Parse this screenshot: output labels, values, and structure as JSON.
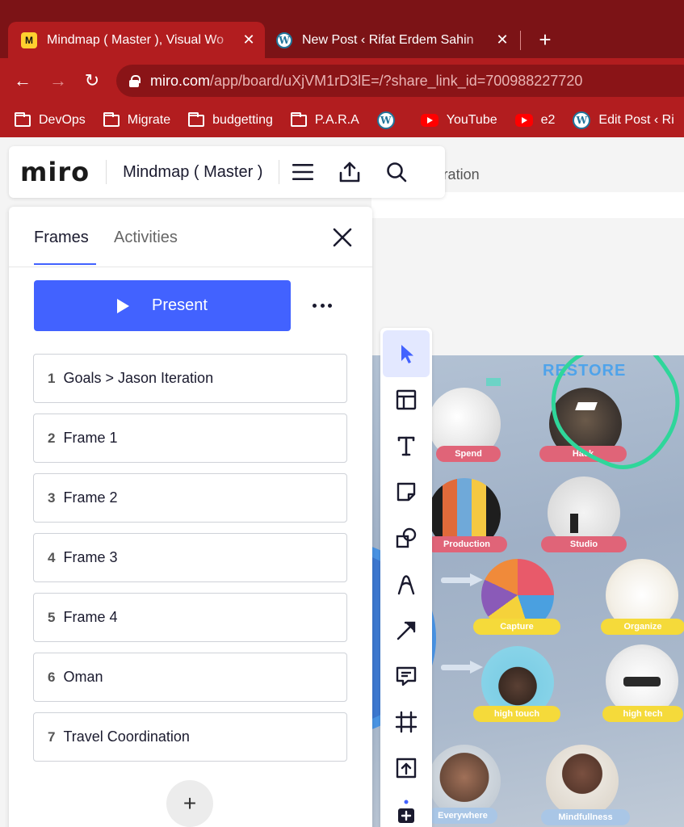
{
  "browser": {
    "tabs": [
      {
        "title": "Mindmap ( Master ), Visual Wo",
        "favicon": "miro-logo",
        "active": true
      },
      {
        "title": "New Post ‹ Rifat Erdem Sahin",
        "favicon": "wordpress-logo",
        "active": false
      }
    ],
    "new_tab": "+",
    "url_host": "miro.com",
    "url_path": "/app/board/uXjVM1rD3lE=/?share_link_id=700988227720",
    "bookmarks": [
      {
        "label": "DevOps",
        "icon": "folder"
      },
      {
        "label": "Migrate",
        "icon": "folder"
      },
      {
        "label": "budgetting",
        "icon": "folder"
      },
      {
        "label": "P.A.R.A",
        "icon": "folder"
      },
      {
        "label": "",
        "icon": "wordpress"
      },
      {
        "label": "YouTube",
        "icon": "youtube"
      },
      {
        "label": "e2",
        "icon": "youtube"
      },
      {
        "label": "Edit Post ‹ Ri",
        "icon": "wordpress"
      }
    ],
    "colors": {
      "tabbar": "#7c1316",
      "toolbar": "#b21d1f"
    }
  },
  "app": {
    "logo": "miro",
    "board_name": "Mindmap ( Master )"
  },
  "panel": {
    "tabs": [
      "Frames",
      "Activities"
    ],
    "present_label": "Present",
    "frames": [
      {
        "num": "1",
        "title": "Goals > Jason Iteration"
      },
      {
        "num": "2",
        "title": "Frame 1"
      },
      {
        "num": "3",
        "title": "Frame 2"
      },
      {
        "num": "4",
        "title": "Frame 3"
      },
      {
        "num": "5",
        "title": "Frame 4"
      },
      {
        "num": "6",
        "title": "Oman"
      },
      {
        "num": "7",
        "title": "Travel Coordination"
      }
    ],
    "add_label": "+",
    "accent": "#4262ff"
  },
  "canvas": {
    "frame_title": "> Jason Iteration",
    "heading": "RESTORE",
    "nodes": [
      {
        "label": "Spend",
        "color": "pink"
      },
      {
        "label": "Hack",
        "color": "pink"
      },
      {
        "label": "Production",
        "color": "pink"
      },
      {
        "label": "Studio",
        "color": "pink"
      },
      {
        "label": "Capture",
        "color": "yellow"
      },
      {
        "label": "Organize",
        "color": "yellow"
      },
      {
        "label": "high touch",
        "color": "yellow"
      },
      {
        "label": "high tech",
        "color": "yellow"
      },
      {
        "label": "Everywhere",
        "color": "blue"
      },
      {
        "label": "Mindfullness",
        "color": "blue"
      }
    ]
  }
}
